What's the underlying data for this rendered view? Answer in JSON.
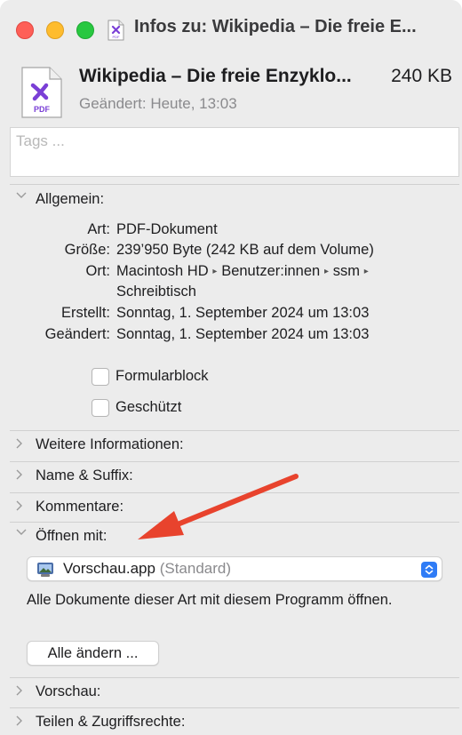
{
  "window": {
    "title": "Infos zu: Wikipedia – Die freie E..."
  },
  "file": {
    "name": "Wikipedia – Die freie Enzyklo...",
    "size": "240 KB",
    "modified": "Geändert: Heute, 13:03",
    "icon_label": "PDF"
  },
  "tags": {
    "placeholder": "Tags ..."
  },
  "general": {
    "header": "Allgemein:",
    "kind_label": "Art:",
    "kind_value": "PDF-Dokument",
    "size_label": "Größe:",
    "size_value": "239’950 Byte (242 KB auf dem Volume)",
    "where_label": "Ort:",
    "where_line1": [
      "Macintosh HD",
      "Benutzer:innen",
      "ssm"
    ],
    "where_line2": "Schreibtisch",
    "created_label": "Erstellt:",
    "created_value": "Sonntag, 1. September 2024 um 13:03",
    "modified_label": "Geändert:",
    "modified_value": "Sonntag, 1. September 2024 um 13:03",
    "stationery_label": "Formularblock",
    "locked_label": "Geschützt"
  },
  "sections": {
    "more_info": "Weitere Informationen:",
    "name_ext": "Name & Suffix:",
    "comments": "Kommentare:",
    "open_with": "Öffnen mit:",
    "preview": "Vorschau:",
    "sharing": "Teilen & Zugriffsrechte:"
  },
  "open_with": {
    "app": "Vorschau.app",
    "app_suffix": "(Standard)",
    "description": "Alle Dokumente dieser Art mit diesem Programm öffnen.",
    "change_all_button": "Alle ändern ..."
  },
  "colors": {
    "annotation_arrow": "#e8432d",
    "pdf_icon_accent": "#7a3fd6",
    "stepper_blue": "#2f7cf6"
  }
}
